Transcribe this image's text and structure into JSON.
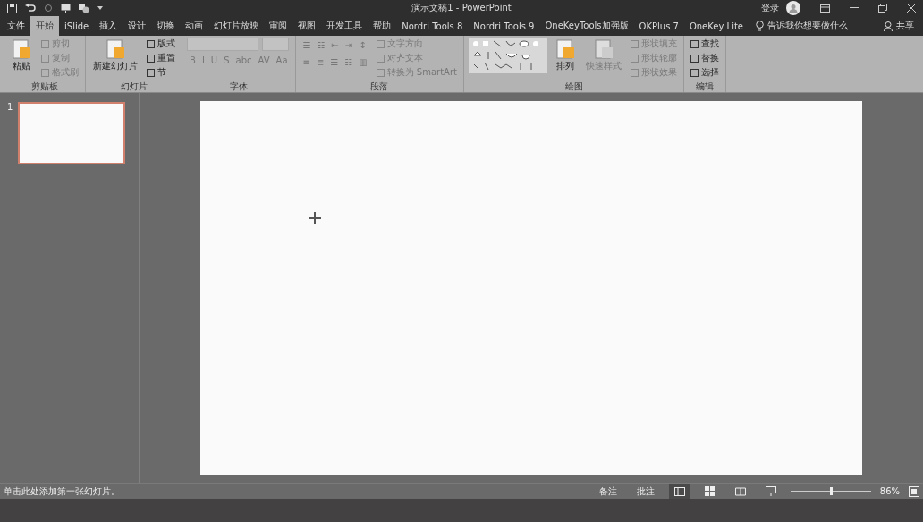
{
  "window": {
    "title": "演示文稿1 - PowerPoint",
    "user": "登录"
  },
  "tabs": [
    {
      "label": "文件",
      "selected": false
    },
    {
      "label": "开始",
      "selected": true
    },
    {
      "label": "iSlide",
      "selected": false
    },
    {
      "label": "插入",
      "selected": false
    },
    {
      "label": "设计",
      "selected": false
    },
    {
      "label": "切换",
      "selected": false
    },
    {
      "label": "动画",
      "selected": false
    },
    {
      "label": "幻灯片放映",
      "selected": false
    },
    {
      "label": "审阅",
      "selected": false
    },
    {
      "label": "视图",
      "selected": false
    },
    {
      "label": "开发工具",
      "selected": false
    },
    {
      "label": "帮助",
      "selected": false
    },
    {
      "label": "Nordri Tools 8",
      "selected": false
    },
    {
      "label": "Nordri Tools 9",
      "selected": false
    },
    {
      "label": "OneKeyTools加强版",
      "selected": false
    },
    {
      "label": "OKPlus 7",
      "selected": false
    },
    {
      "label": "OneKey Lite",
      "selected": false
    }
  ],
  "tell_me": "告诉我你想要做什么",
  "share": "共享",
  "ribbon": [
    {
      "label": "剪贴板",
      "columns": [
        [
          {
            "kind": "large",
            "label": "粘贴",
            "disabled": false
          }
        ],
        [
          {
            "kind": "small",
            "label": "剪切",
            "disabled": true
          },
          {
            "kind": "small",
            "label": "复制",
            "disabled": true
          },
          {
            "kind": "small",
            "label": "格式刷",
            "disabled": true
          }
        ]
      ]
    },
    {
      "label": "幻灯片",
      "columns": [
        [
          {
            "kind": "large",
            "label": "新建幻灯片",
            "disabled": false
          }
        ],
        [
          {
            "kind": "small",
            "label": "版式",
            "disabled": false
          },
          {
            "kind": "small",
            "label": "重置",
            "disabled": false
          },
          {
            "kind": "small",
            "label": "节",
            "disabled": false
          }
        ]
      ]
    },
    {
      "label": "字体",
      "columns": [
        [
          {
            "kind": "fields",
            "disabled": true
          },
          {
            "kind": "glyphs",
            "glyphs": [
              "B",
              "I",
              "U",
              "S",
              "abc",
              "AV",
              "Aa"
            ],
            "disabled": true
          }
        ]
      ]
    },
    {
      "label": "段落",
      "columns": [
        [
          {
            "kind": "glyphs",
            "glyphs": [
              "☰",
              "☷",
              "⇤",
              "⇥",
              "↕"
            ],
            "disabled": true
          },
          {
            "kind": "glyphs",
            "glyphs": [
              "≡",
              "≣",
              "☰",
              "☷",
              "▥"
            ],
            "disabled": true
          }
        ],
        [
          {
            "kind": "small",
            "label": "文字方向",
            "disabled": true
          },
          {
            "kind": "small",
            "label": "对齐文本",
            "disabled": true
          },
          {
            "kind": "small",
            "label": "转换为 SmartArt",
            "disabled": true
          }
        ]
      ]
    },
    {
      "label": "绘图",
      "columns": [
        [
          {
            "kind": "gallery",
            "disabled": false
          }
        ],
        [
          {
            "kind": "large",
            "label": "排列",
            "disabled": false
          }
        ],
        [
          {
            "kind": "large",
            "label": "快速样式",
            "disabled": true
          }
        ],
        [
          {
            "kind": "small",
            "label": "形状填充",
            "disabled": true
          },
          {
            "kind": "small",
            "label": "形状轮廓",
            "disabled": true
          },
          {
            "kind": "small",
            "label": "形状效果",
            "disabled": true
          }
        ]
      ]
    },
    {
      "label": "编辑",
      "columns": [
        [
          {
            "kind": "small",
            "label": "查找",
            "disabled": false
          },
          {
            "kind": "small",
            "label": "替换",
            "disabled": false
          },
          {
            "kind": "small",
            "label": "选择",
            "disabled": false
          }
        ]
      ]
    }
  ],
  "thumbnails": [
    {
      "number": "1",
      "selected": true
    }
  ],
  "status_bar": {
    "text": "单击此处添加第一张幻灯片。",
    "notes": "备注",
    "comments": "批注",
    "views": [
      {
        "kind": "normal",
        "selected": true
      },
      {
        "kind": "sorter",
        "selected": false
      },
      {
        "kind": "reading",
        "selected": false
      },
      {
        "kind": "slideshow",
        "selected": false
      }
    ],
    "zoom": {
      "level": 0.5,
      "reading": "86%"
    }
  }
}
